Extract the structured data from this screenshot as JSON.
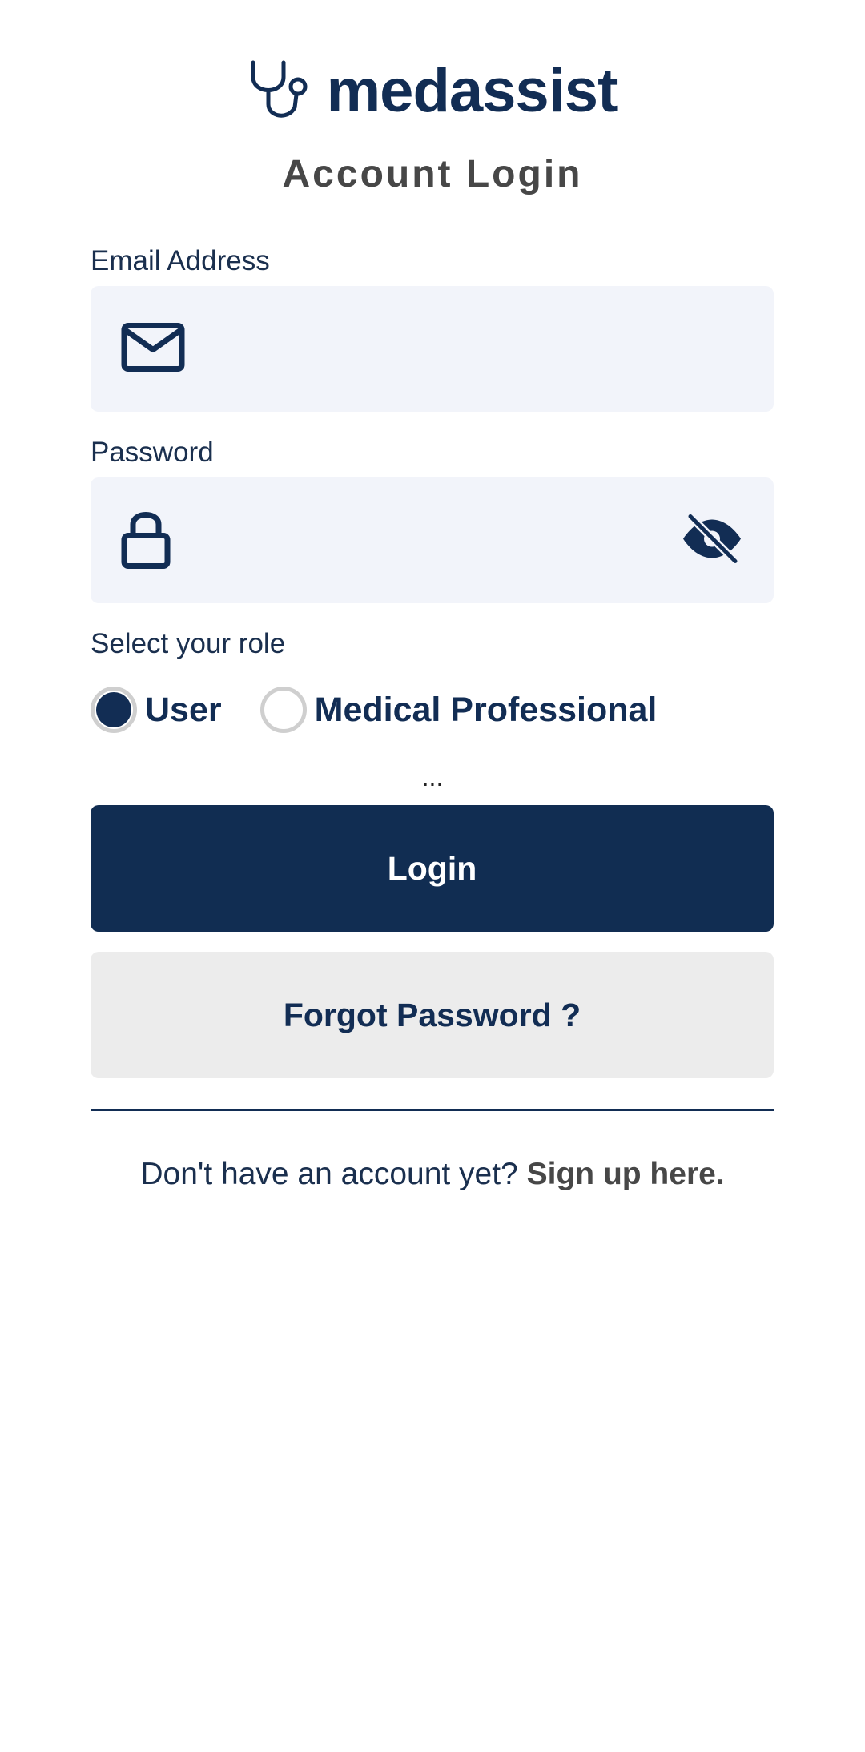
{
  "brand": {
    "name_part1": "med",
    "name_part2": "assist",
    "icon": "stethoscope-icon",
    "color": "#122d54"
  },
  "page_title": "Account Login",
  "email": {
    "label": "Email Address",
    "value": "",
    "icon": "mail-icon"
  },
  "password": {
    "label": "Password",
    "value": "",
    "icon": "lock-icon",
    "visibility_icon": "eye-off-icon"
  },
  "role": {
    "label": "Select your role",
    "options": [
      "User",
      "Medical Professional"
    ],
    "selected": "User"
  },
  "status_ellipsis": "...",
  "buttons": {
    "login": "Login",
    "forgot": "Forgot Password ?"
  },
  "signup": {
    "prompt": "Don't have an account yet?",
    "link": "Sign up here."
  },
  "colors": {
    "primary": "#112d52",
    "field_bg": "#f2f4fa",
    "secondary_button_bg": "#ececec",
    "title_gray": "#474747"
  }
}
